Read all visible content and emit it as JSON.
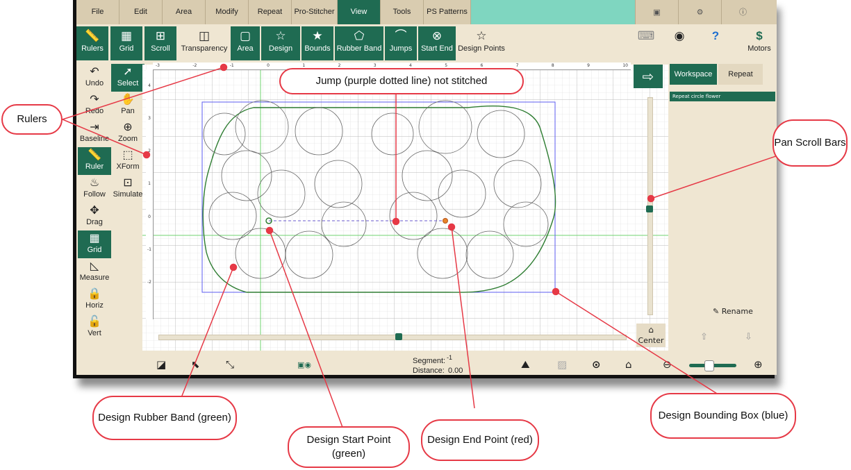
{
  "menus": [
    "File",
    "Edit",
    "Area",
    "Modify",
    "Repeat",
    "Pro-Stitcher",
    "View",
    "Tools",
    "PS Patterns"
  ],
  "active_menu": "View",
  "toolbar": {
    "rulers": "Rulers",
    "grid": "Grid",
    "scroll": "Scroll",
    "transparency": "Transparency",
    "area": "Area",
    "design": "Design",
    "bounds": "Bounds",
    "rubber_band": "Rubber Band",
    "jumps": "Jumps",
    "start_end": "Start End",
    "design_points": "Design Points",
    "motors": "Motors"
  },
  "left_tools": {
    "undo": "Undo",
    "select": "Select",
    "redo": "Redo",
    "pan": "Pan",
    "baseline": "Baseline",
    "zoom": "Zoom",
    "ruler": "Ruler",
    "xform": "XForm",
    "follow": "Follow",
    "simulate": "Simulate",
    "drag": "Drag",
    "grid": "Grid",
    "measure": "Measure",
    "horiz": "Horiz",
    "vert": "Vert"
  },
  "ruler": {
    "h_ticks": [
      "-3",
      "-2",
      "-1",
      "0",
      "1",
      "2",
      "3",
      "4",
      "5",
      "6",
      "7",
      "8",
      "9",
      "10"
    ],
    "v_ticks": [
      "4",
      "3",
      "2",
      "1",
      "0",
      "-1",
      "-2"
    ]
  },
  "right_panel": {
    "tab_workspace": "Workspace",
    "tab_repeat": "Repeat",
    "list_item": "Repeat circle flower",
    "rename": "Rename",
    "center": "Center"
  },
  "status": {
    "segment_label": "Segment:",
    "segment_value": "-1",
    "distance_label": "Distance:",
    "distance_value": "0.00"
  },
  "callouts": {
    "rulers": "Rulers",
    "jump": "Jump (purple dotted line) not stitched",
    "pan_scroll": "Pan Scroll Bars",
    "rubber_band": "Design Rubber Band (green)",
    "start_point": "Design Start Point (green)",
    "end_point": "Design End Point (red)",
    "bounding_box": "Design Bounding Box (blue)"
  },
  "colors": {
    "accent": "#1f6b52",
    "menu_fill": "#7fd6c0",
    "callout": "#e63946",
    "bounds": "#5b5bf0",
    "rubber_band": "#2e7d32",
    "jump": "#6a5acd"
  }
}
